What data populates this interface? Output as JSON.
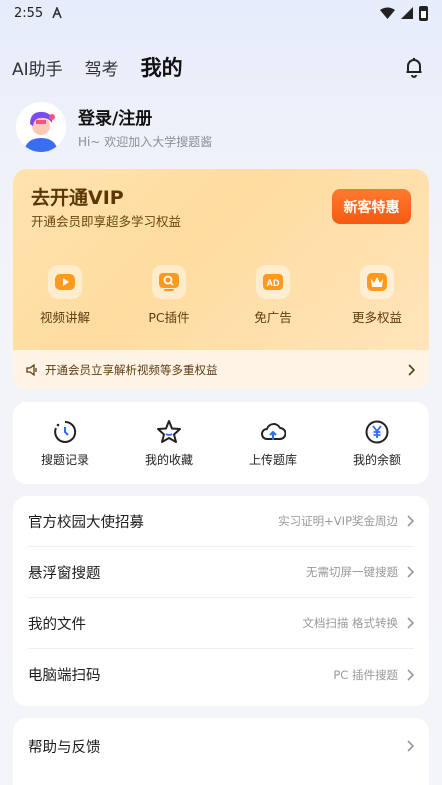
{
  "status": {
    "time": "2:55"
  },
  "nav": {
    "tabs": [
      "AI助手",
      "驾考",
      "我的"
    ]
  },
  "profile": {
    "title": "登录/注册",
    "subtitle": "Hi~ 欢迎加入大学搜题酱"
  },
  "vip": {
    "title": "去开通VIP",
    "subtitle": "开通会员即享超多学习权益",
    "button": "新客特惠",
    "perks": [
      "视频讲解",
      "PC插件",
      "免广告",
      "更多权益"
    ],
    "perk_icons": [
      "play-icon",
      "search-icon",
      "ad-icon",
      "crown-icon"
    ],
    "banner": "开通会员立享解析视频等多重权益"
  },
  "quick": {
    "items": [
      "搜题记录",
      "我的收藏",
      "上传题库",
      "我的余额"
    ],
    "icons": [
      "history-icon",
      "star-icon",
      "cloud-upload-icon",
      "yuan-icon"
    ]
  },
  "menu": [
    {
      "label": "官方校园大使招募",
      "hint": "实习证明+VIP奖金周边"
    },
    {
      "label": "悬浮窗搜题",
      "hint": "无需切屏一键搜题"
    },
    {
      "label": "我的文件",
      "hint": "文档扫描 格式转换"
    },
    {
      "label": "电脑端扫码",
      "hint": "PC 插件搜题"
    }
  ],
  "menu2": [
    {
      "label": "帮助与反馈"
    }
  ],
  "colors": {
    "accent": "#f55a10",
    "vip_text": "#5d3608",
    "bg": "#f4f5f8"
  }
}
